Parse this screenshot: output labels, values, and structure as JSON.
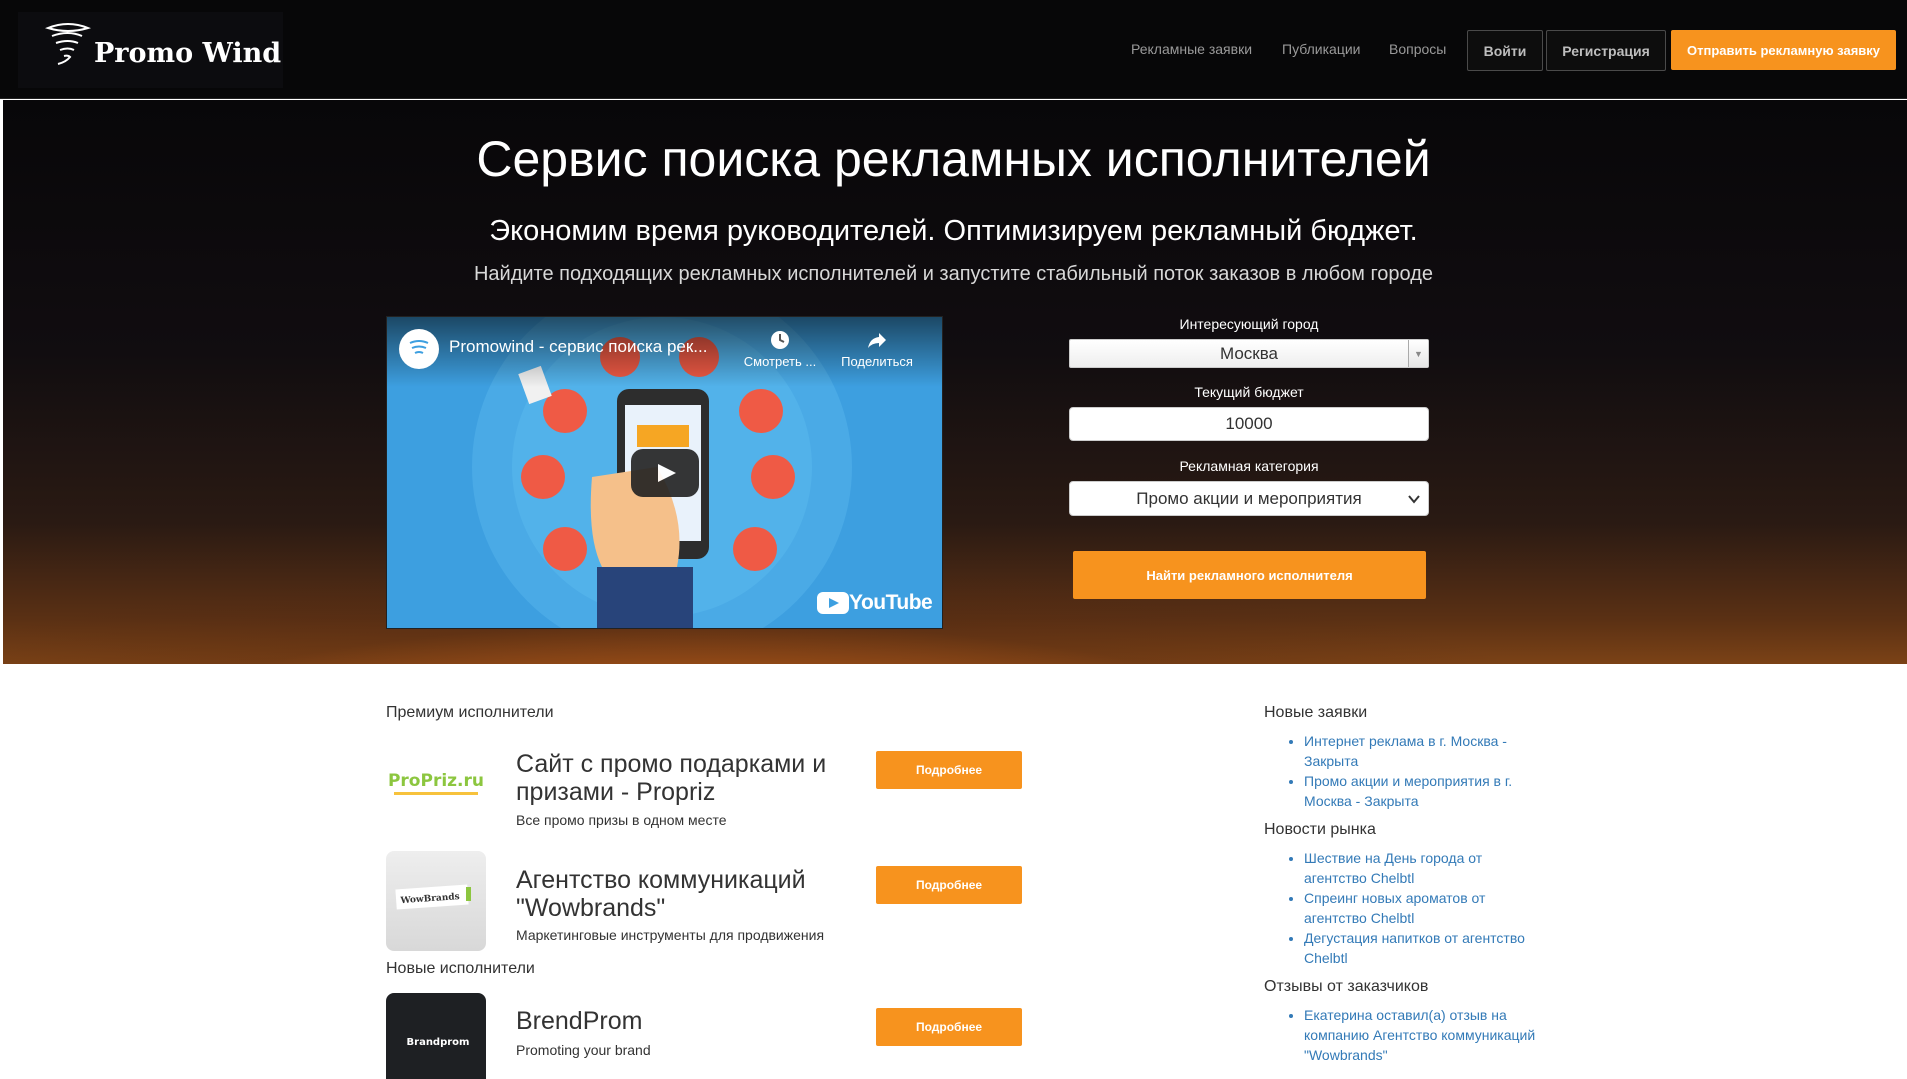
{
  "brand": {
    "name": "Promo Wind"
  },
  "nav": {
    "links": [
      "Рекламные заявки",
      "Публикации",
      "Вопросы"
    ],
    "login": "Войти",
    "register": "Регистрация",
    "cta": "Отправить рекламную заявку"
  },
  "hero": {
    "title": "Сервис поиска рекламных исполнителей",
    "subtitle": "Экономим время руководителей. Оптимизируем рекламный бюджет.",
    "subtitle2": "Найдите подходящих рекламных исполнителей и запустите стабильный поток заказов в любом городе"
  },
  "video": {
    "title": "Promowind - сервис поиска рек...",
    "watch_later": "Смотреть ...",
    "share": "Поделиться",
    "platform": "YouTube"
  },
  "form": {
    "city_label": "Интересующий город",
    "city_value": "Москва",
    "budget_label": "Текущий бюджет",
    "budget_value": "10000",
    "category_label": "Рекламная категория",
    "category_value": "Промо акции и мероприятия",
    "submit": "Найти рекламного исполнителя"
  },
  "premium": {
    "heading": "Премиум исполнители",
    "items": [
      {
        "logo_text": "ProPriz.ru",
        "title": "Сайт с промо подарками и призами - Propriz",
        "desc": "Все промо призы в одном месте",
        "button": "Подробнее"
      },
      {
        "logo_text": "WowBrands",
        "title": "Агентство коммуникаций \"Wowbrands\"",
        "desc": "Маркетинговые инструменты для продвижения",
        "button": "Подробнее"
      }
    ]
  },
  "new_performers": {
    "heading": "Новые исполнители",
    "items": [
      {
        "logo_text": "Brandprom",
        "title": "BrendProm",
        "desc": "Promoting your brand",
        "button": "Подробнее"
      }
    ]
  },
  "sidebar": {
    "new_requests": {
      "heading": "Новые заявки",
      "items": [
        "Интернет реклама в г. Москва - Закрыта",
        "Промо акции и мероприятия в г. Москва - Закрыта"
      ]
    },
    "market_news": {
      "heading": "Новости рынка",
      "items": [
        "Шествие на День города от агентство Chelbtl",
        "Спреинг новых ароматов от агентство Chelbtl",
        "Дегустация напитков от агентство Chelbtl"
      ]
    },
    "reviews": {
      "heading": "Отзывы от заказчиков",
      "items": [
        "Екатерина оставил(а) отзыв на компанию Агентство коммуникаций \"Wowbrands\""
      ]
    }
  },
  "colors": {
    "accent": "#f7931e",
    "link": "#337ab7",
    "nav_bg": "#070708"
  }
}
